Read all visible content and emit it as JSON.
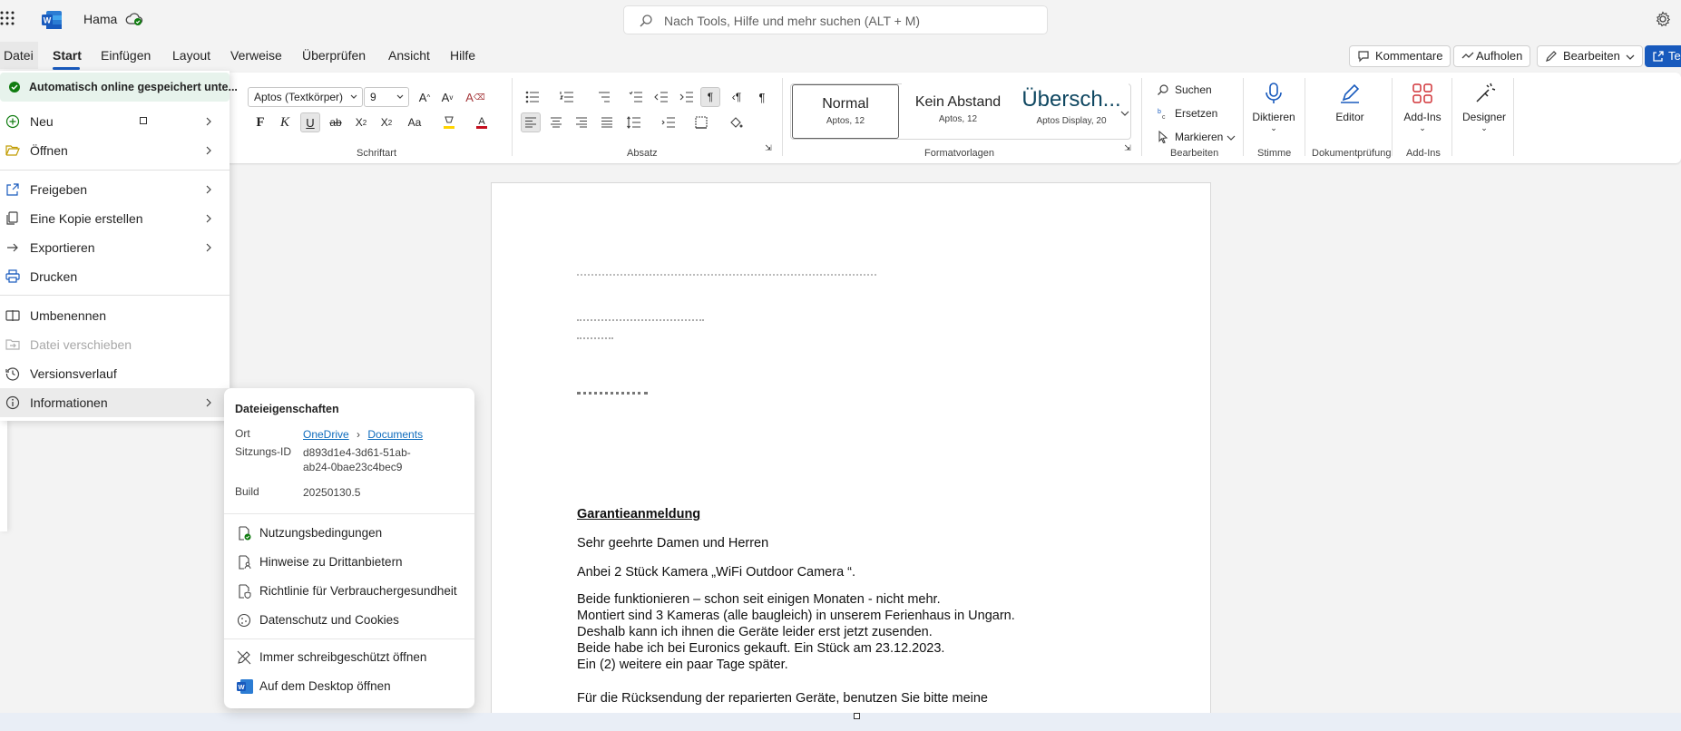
{
  "app": {
    "doc_title": "Hama",
    "search_placeholder": "Nach Tools, Hilfe und mehr suchen (ALT + M)"
  },
  "tabs": [
    "Datei",
    "Start",
    "Einfügen",
    "Layout",
    "Verweise",
    "Überprüfen",
    "Ansicht",
    "Hilfe"
  ],
  "header_buttons": {
    "kommentare": "Kommentare",
    "aufholen": "Aufholen",
    "bearbeiten": "Bearbeiten",
    "teilen": "Te"
  },
  "ribbon": {
    "font_name": "Aptos (Textkörper)",
    "font_size": "9",
    "bold": "F",
    "italic": "K",
    "underline": "U",
    "groups": {
      "schriftart": "Schriftart",
      "absatz": "Absatz",
      "formatvorlagen": "Formatvorlagen",
      "bearbeiten": "Bearbeiten",
      "stimme": "Stimme",
      "dokumentpruefung": "Dokumentprüfung",
      "addins": "Add-Ins"
    },
    "styles": [
      {
        "name": "Normal",
        "sub": "Aptos, 12"
      },
      {
        "name": "Kein Abstand",
        "sub": "Aptos, 12"
      },
      {
        "name": "Übersch...",
        "sub": "Aptos Display, 20"
      }
    ],
    "suchen": "Suchen",
    "ersetzen": "Ersetzen",
    "markieren": "Markieren",
    "diktieren": "Diktieren",
    "editor": "Editor",
    "addins": "Add-Ins",
    "designer": "Designer"
  },
  "document": {
    "heading": "Garantieanmeldung",
    "lines": [
      "Sehr geehrte Damen und Herren",
      "Anbei 2 Stück Kamera „WiFi Outdoor Camera “.",
      "Beide funktionieren – schon seit einigen Monaten - nicht mehr.",
      "Montiert sind 3 Kameras (alle baugleich) in unserem Ferienhaus in Ungarn.",
      "Deshalb kann ich ihnen die Geräte leider erst jetzt zusenden.",
      "Beide habe ich bei Euronics gekauft. Ein Stück am 23.12.2023.",
      "Ein (2) weitere ein paar Tage später.",
      "Für die Rücksendung der reparierten Geräte, benutzen Sie bitte meine"
    ]
  },
  "datei_menu": {
    "autosave": "Automatisch online gespeichert unte...",
    "items": {
      "neu": "Neu",
      "oeffnen": "Öffnen",
      "freigeben": "Freigeben",
      "kopie": "Eine Kopie erstellen",
      "exportieren": "Exportieren",
      "drucken": "Drucken",
      "umbenennen": "Umbenennen",
      "verschieben": "Datei verschieben",
      "versionsverlauf": "Versionsverlauf",
      "informationen": "Informationen"
    }
  },
  "info_panel": {
    "title": "Dateieigenschaften",
    "ort_label": "Ort",
    "ort_path": [
      "OneDrive",
      "Documents"
    ],
    "session_label": "Sitzungs-ID",
    "session_id_line1": "d893d1e4-3d61-51ab-",
    "session_id_line2": "ab24-0bae23c4bec9",
    "build_label": "Build",
    "build": "20250130.5",
    "links": {
      "nutzung": "Nutzungsbedingungen",
      "hinweise": "Hinweise zu Drittanbietern",
      "richtlinie": "Richtlinie für Verbrauchergesundheit",
      "datenschutz": "Datenschutz und Cookies",
      "schreibgeschuetzt": "Immer schreibgeschützt öffnen",
      "desktop": "Auf dem Desktop öffnen"
    }
  },
  "colors": {
    "brand": "#185abd",
    "link": "#0f6cbd",
    "autosave_bg": "#e7f3ec",
    "save_green": "#107c10"
  }
}
